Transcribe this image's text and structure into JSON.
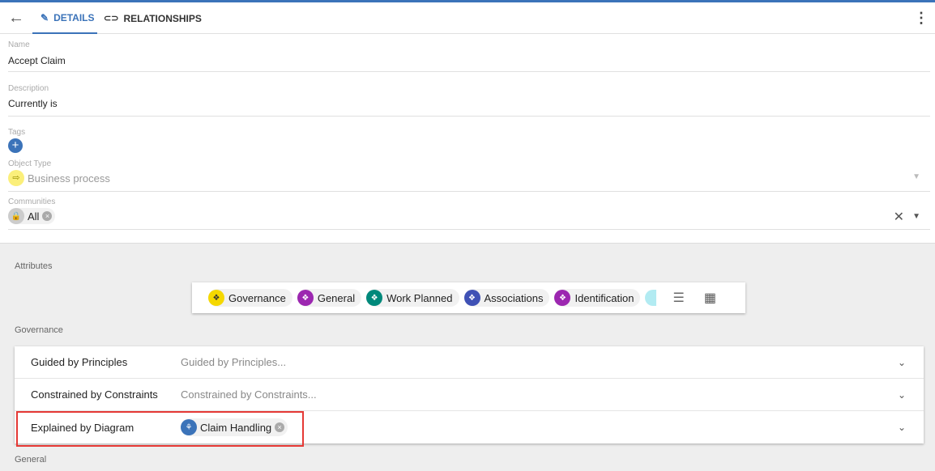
{
  "tabs": {
    "details": "DETAILS",
    "relationships": "RELATIONSHIPS"
  },
  "fields": {
    "name": {
      "label": "Name",
      "value": "Accept Claim"
    },
    "description": {
      "label": "Description",
      "value": "Currently is"
    },
    "tags": {
      "label": "Tags"
    },
    "object_type": {
      "label": "Object Type",
      "value": "Business process"
    },
    "communities": {
      "label": "Communities",
      "value": "All"
    }
  },
  "attributes": {
    "label": "Attributes",
    "chips": [
      {
        "label": "Governance",
        "color": "#f5d800"
      },
      {
        "label": "General",
        "color": "#9c27b0"
      },
      {
        "label": "Work Planned",
        "color": "#00897b"
      },
      {
        "label": "Associations",
        "color": "#3f51b5"
      },
      {
        "label": "Identification",
        "color": "#9c27b0"
      }
    ]
  },
  "governance": {
    "label": "Governance",
    "rows": [
      {
        "label": "Guided by Principles",
        "placeholder": "Guided by Principles..."
      },
      {
        "label": "Constrained by Constraints",
        "placeholder": "Constrained by Constraints..."
      },
      {
        "label": "Explained by Diagram",
        "value": "Claim Handling"
      }
    ]
  },
  "general": {
    "label": "General"
  },
  "colors": {
    "accent": "#3b73b9",
    "highlight": "#e53935"
  }
}
